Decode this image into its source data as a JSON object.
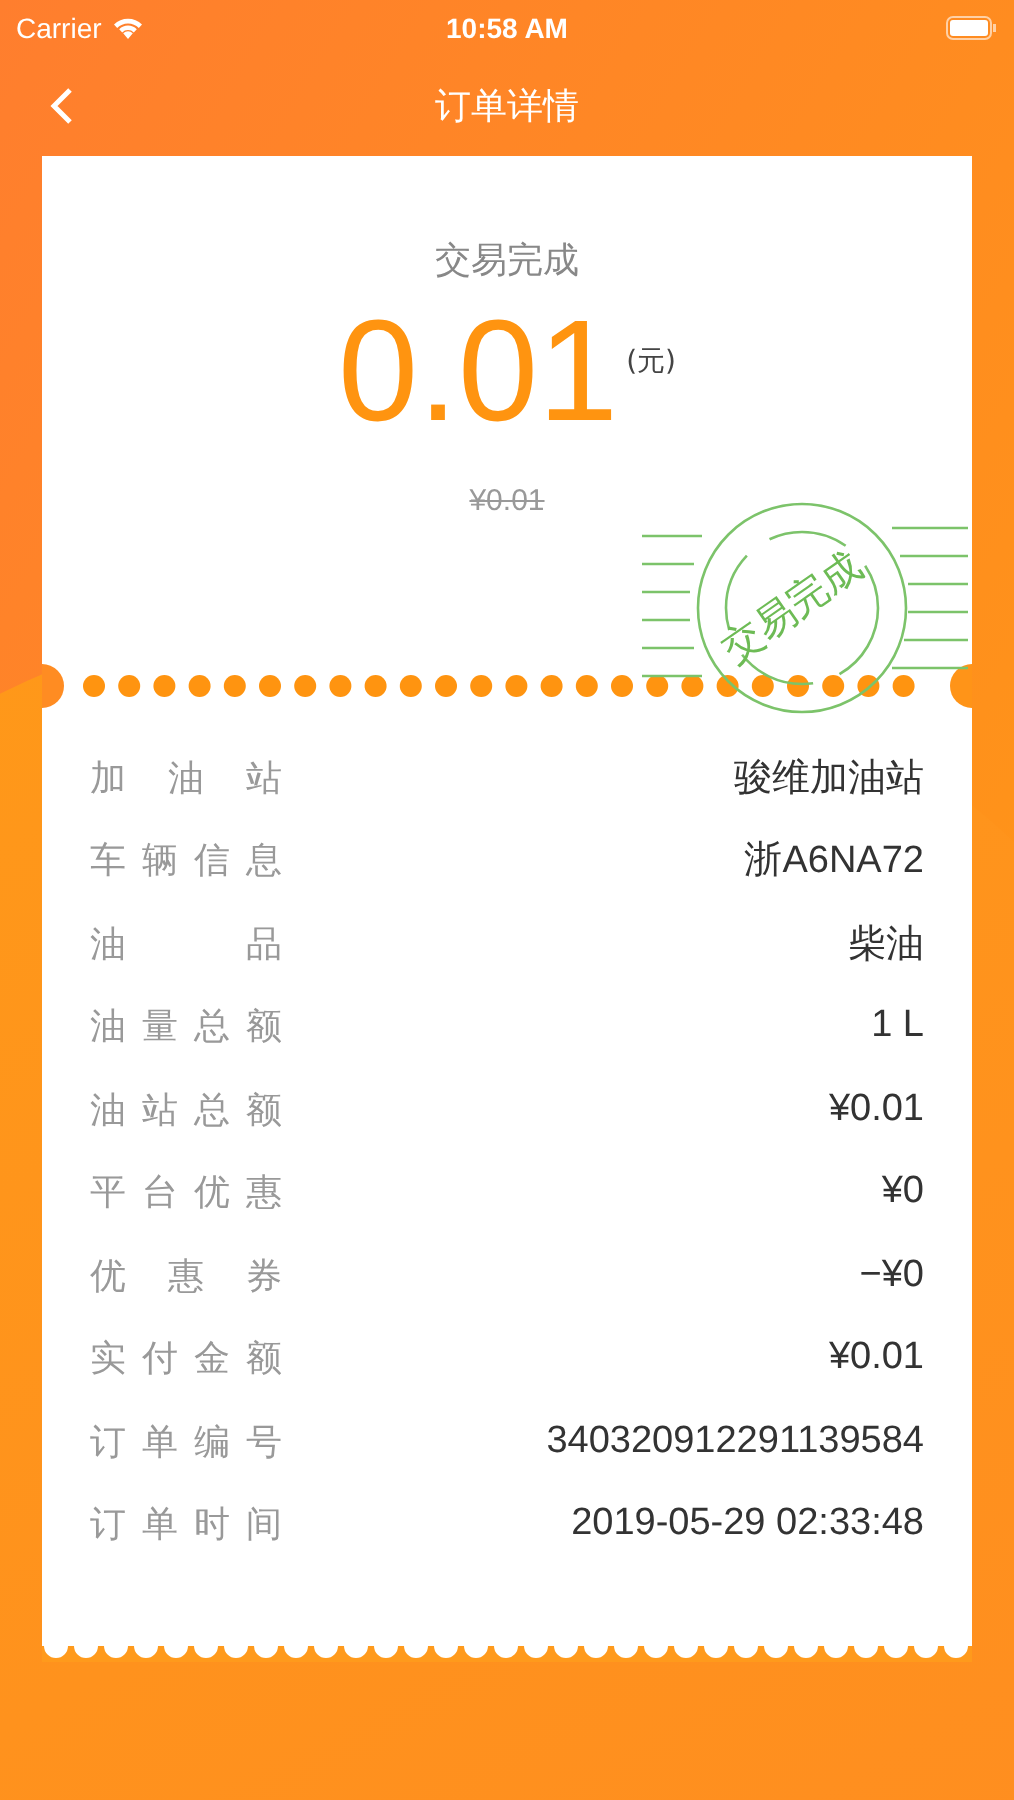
{
  "status_bar": {
    "carrier": "Carrier",
    "time": "10:58 AM"
  },
  "nav": {
    "title": "订单详情"
  },
  "summary": {
    "status": "交易完成",
    "amount": "0.01",
    "unit": "(元)",
    "original_price": "¥0.01",
    "stamp": "交易完成"
  },
  "details": [
    {
      "label": "加油站",
      "value": "骏维加油站"
    },
    {
      "label": "车辆信息",
      "value": "浙A6NA72"
    },
    {
      "label": "油品",
      "value": "柴油"
    },
    {
      "label": "油量总额",
      "value": "1 L"
    },
    {
      "label": "油站总额",
      "value": "¥0.01"
    },
    {
      "label": "平台优惠",
      "value": "¥0"
    },
    {
      "label": "优惠券",
      "value": "−¥0"
    },
    {
      "label": "实付金额",
      "value": "¥0.01"
    },
    {
      "label": "订单编号",
      "value": "340320912291139584"
    },
    {
      "label": "订单时间",
      "value": "2019-05-29 02:33:48"
    }
  ]
}
